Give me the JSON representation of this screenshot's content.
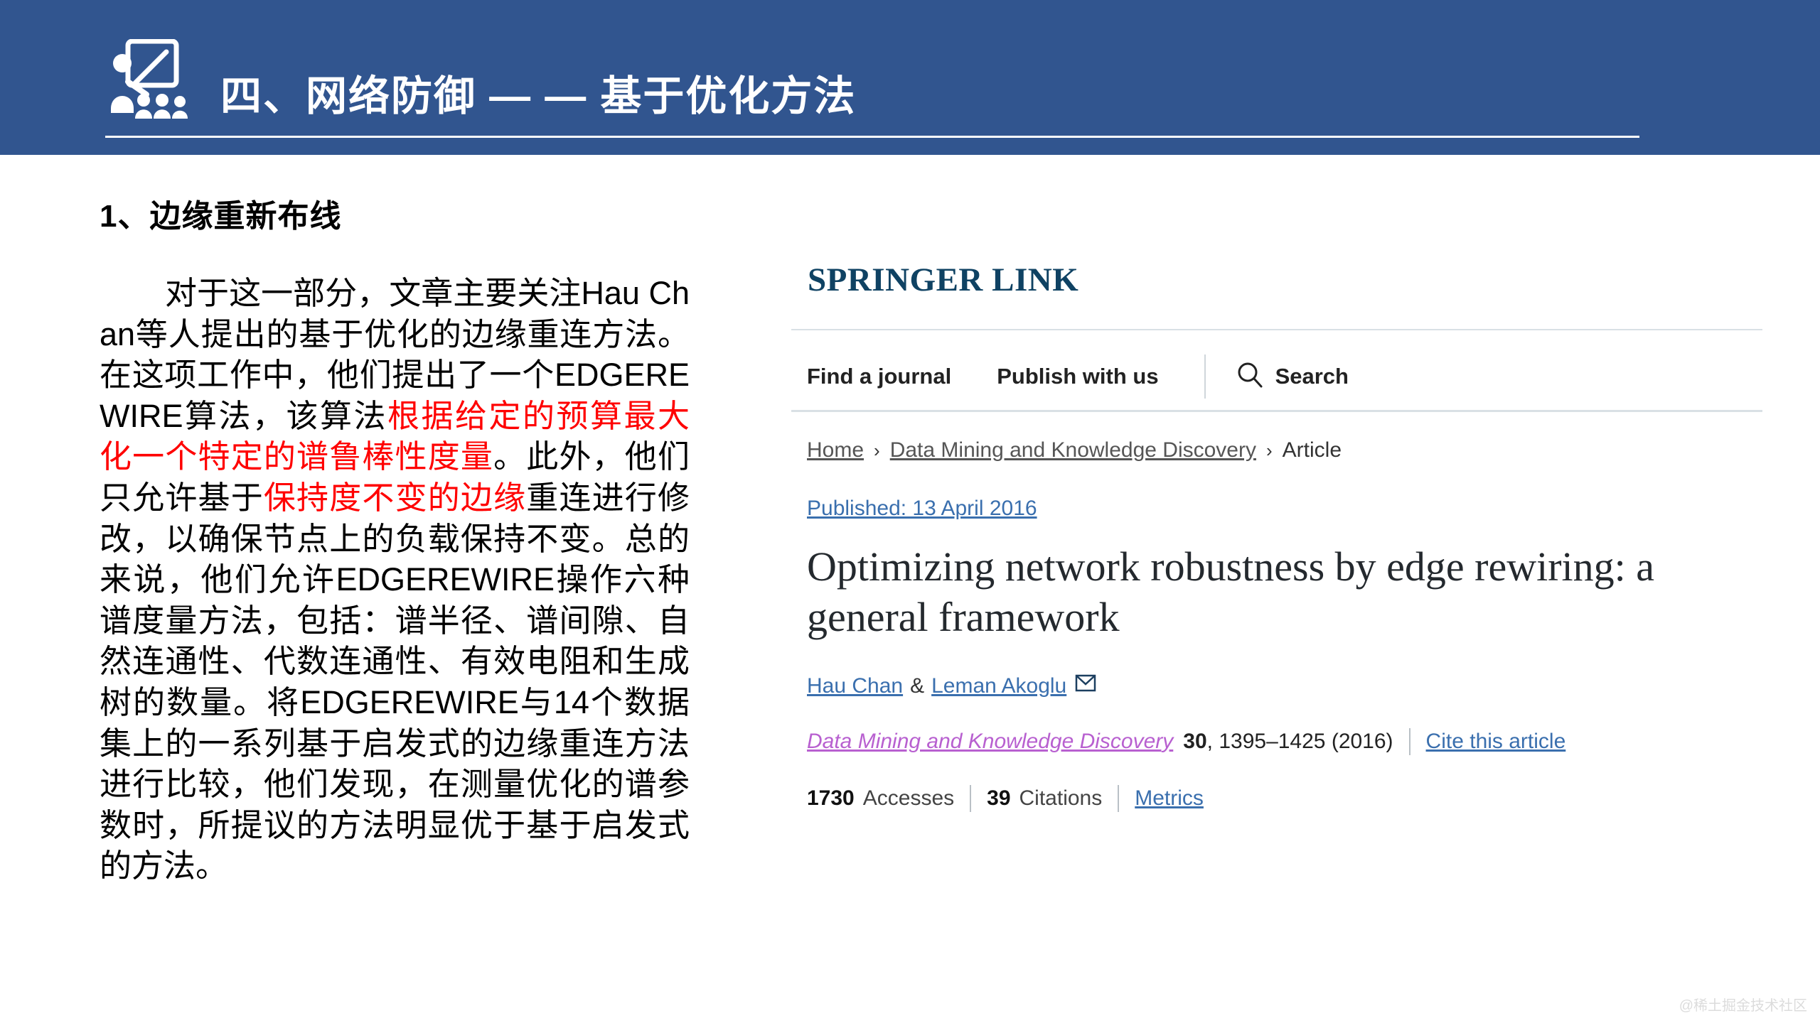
{
  "slide": {
    "header": {
      "title": "四、网络防御 — — 基于优化方法",
      "icon": "presenter-whiteboard-icon",
      "background_color": "#31558f",
      "text_color": "#ffffff"
    },
    "section_heading": "1、边缘重新布线",
    "paragraph": {
      "segments": [
        {
          "text": "对于这一部分，文章主要关注Hau Chan等人提出的基于优化的边缘重连方法。在这项工作中，他们提出了一个EDGEREWIRE算法，该算法",
          "color": "#000000"
        },
        {
          "text": "根据给定的预算最大化一个特定的谱鲁棒性度量",
          "color": "#ff0000"
        },
        {
          "text": "。此外，他们只允许基于",
          "color": "#000000"
        },
        {
          "text": "保持度不变的边缘",
          "color": "#ff0000"
        },
        {
          "text": "重连进行修改，以确保节点上的负载保持不变。总的来说，他们允许EDGEREWIRE操作六种谱度量方法，包括：谱半径、谱间隙、自然连通性、代数连通性、有效电阻和生成树的数量。将EDGEREWIRE与14个数据集上的一系列基于启发式的边缘重连方法进行比较，他们发现，在测量优化的谱参数时，所提议的方法明显优于基于启发式的方法。",
          "color": "#000000"
        }
      ],
      "highlight_color": "#ff0000"
    }
  },
  "springer": {
    "logo": {
      "word1": "S",
      "word1_rest": "PRINGER",
      "word2": "L",
      "word2_rest": "INK",
      "full": "SPRINGER LINK",
      "color": "#0f4263"
    },
    "nav": {
      "items": [
        {
          "label": "Find a journal",
          "name": "find-a-journal"
        },
        {
          "label": "Publish with us",
          "name": "publish-with-us"
        }
      ],
      "search_label": "Search",
      "search_icon": "search-icon"
    },
    "breadcrumb": {
      "home": "Home",
      "journal": "Data Mining and Knowledge Discovery",
      "current": "Article",
      "separator": "›"
    },
    "published": "Published: 13 April 2016",
    "article_title": "Optimizing network robustness by edge rewiring: a general framework",
    "authors": {
      "first": "Hau Chan",
      "conjunction": "&",
      "second": "Leman Akoglu",
      "mail_icon": "envelope-icon"
    },
    "citation": {
      "journal": "Data Mining and Knowledge Discovery",
      "volume": "30",
      "pages_year": ", 1395–1425 (2016)",
      "cite_link": "Cite this article",
      "journal_color": "#b860d0",
      "link_color": "#3a6fae"
    },
    "metrics": {
      "accesses_count": "1730",
      "accesses_label": "Accesses",
      "citations_count": "39",
      "citations_label": "Citations",
      "metrics_link": "Metrics"
    }
  },
  "watermark": "@稀土掘金技术社区"
}
